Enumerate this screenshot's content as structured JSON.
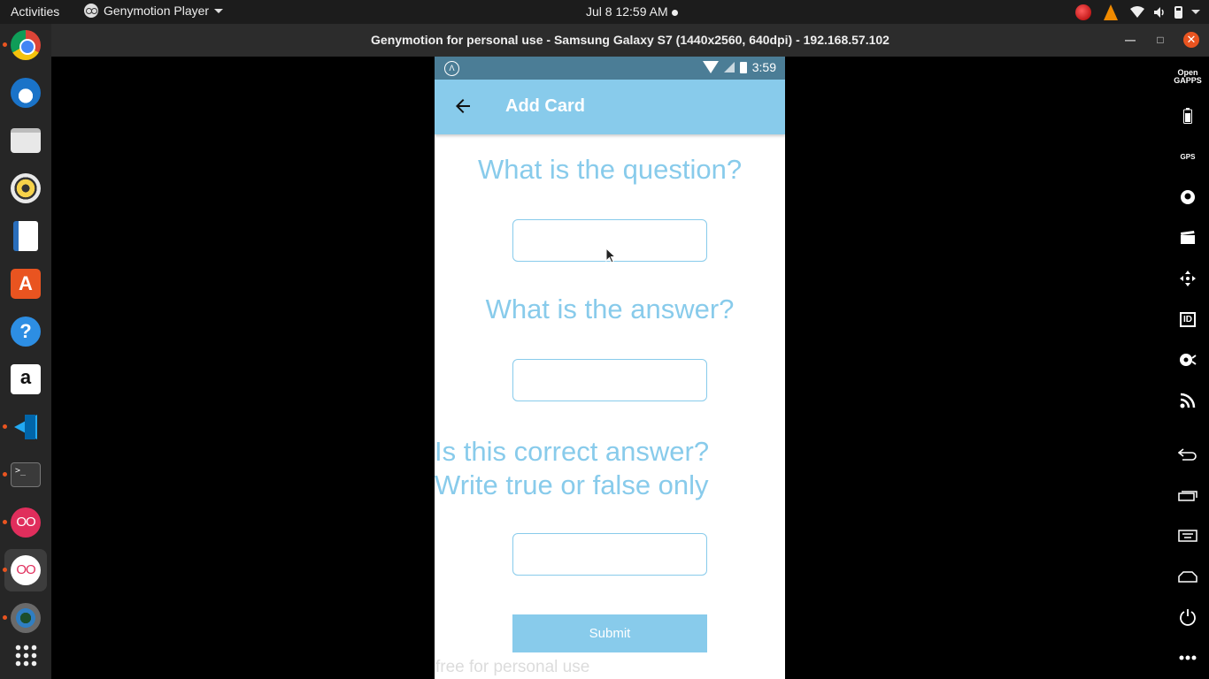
{
  "topbar": {
    "activities": "Activities",
    "app_menu": "Genymotion Player",
    "clock": "Jul 8  12:59 AM"
  },
  "dock": {
    "items": [
      {
        "name": "chrome",
        "running": true
      },
      {
        "name": "thunderbird",
        "running": false
      },
      {
        "name": "files",
        "running": false
      },
      {
        "name": "rhythmbox",
        "running": false
      },
      {
        "name": "libreoffice-writer",
        "running": false
      },
      {
        "name": "ubuntu-software",
        "running": false,
        "glyph": "A"
      },
      {
        "name": "help",
        "running": false,
        "glyph": "?"
      },
      {
        "name": "amazon",
        "running": false,
        "glyph": "a"
      },
      {
        "name": "vscode",
        "running": true
      },
      {
        "name": "terminal",
        "running": true,
        "glyph": ">_"
      },
      {
        "name": "genymotion",
        "running": true,
        "glyph": "OO"
      },
      {
        "name": "genymotion-player",
        "running": true,
        "glyph": "OO",
        "active": true
      },
      {
        "name": "webcam",
        "running": true
      },
      {
        "name": "show-applications",
        "running": false
      }
    ]
  },
  "window": {
    "title": "Genymotion for personal use - Samsung Galaxy S7 (1440x2560, 640dpi) - 192.168.57.102"
  },
  "phone": {
    "status_time": "3:59",
    "appbar_title": "Add Card",
    "question_label": "What is the question?",
    "answer_label": "What is the answer?",
    "correct_label_line1": "Is this correct answer?",
    "correct_label_line2": "Write true or false only",
    "question_value": "",
    "answer_value": "",
    "correct_value": "",
    "submit_label": "Submit",
    "watermark": "free for personal use"
  },
  "sidebar_tools": [
    {
      "name": "open-gapps",
      "label": "Open GAPPS"
    },
    {
      "name": "battery"
    },
    {
      "name": "gps",
      "label": "GPS"
    },
    {
      "name": "camera"
    },
    {
      "name": "media"
    },
    {
      "name": "move"
    },
    {
      "name": "identifiers",
      "label": "ID"
    },
    {
      "name": "disk-io"
    },
    {
      "name": "network"
    },
    {
      "name": "back"
    },
    {
      "name": "recent-apps"
    },
    {
      "name": "menu"
    },
    {
      "name": "home"
    },
    {
      "name": "power"
    },
    {
      "name": "more"
    }
  ]
}
